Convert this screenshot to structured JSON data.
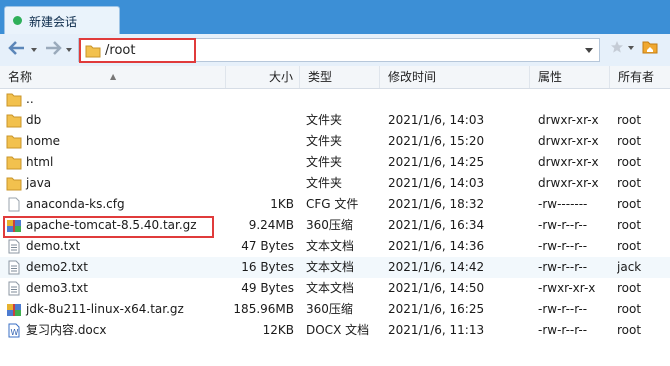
{
  "tab": {
    "label": "新建会话"
  },
  "address": {
    "path": "/root"
  },
  "columns": {
    "name": "名称",
    "size": "大小",
    "type": "类型",
    "mtime": "修改时间",
    "perm": "属性",
    "owner": "所有者"
  },
  "files": [
    {
      "name": "..",
      "size": "",
      "type": "",
      "mtime": "",
      "perm": "",
      "owner": "",
      "icon": "folder-up-icon"
    },
    {
      "name": "db",
      "size": "",
      "type": "文件夹",
      "mtime": "2021/1/6, 14:03",
      "perm": "drwxr-xr-x",
      "owner": "root",
      "icon": "folder-icon"
    },
    {
      "name": "home",
      "size": "",
      "type": "文件夹",
      "mtime": "2021/1/6, 15:20",
      "perm": "drwxr-xr-x",
      "owner": "root",
      "icon": "folder-icon"
    },
    {
      "name": "html",
      "size": "",
      "type": "文件夹",
      "mtime": "2021/1/6, 14:25",
      "perm": "drwxr-xr-x",
      "owner": "root",
      "icon": "folder-icon"
    },
    {
      "name": "java",
      "size": "",
      "type": "文件夹",
      "mtime": "2021/1/6, 14:03",
      "perm": "drwxr-xr-x",
      "owner": "root",
      "icon": "folder-icon"
    },
    {
      "name": "anaconda-ks.cfg",
      "size": "1KB",
      "type": "CFG 文件",
      "mtime": "2021/1/6, 18:32",
      "perm": "-rw-------",
      "owner": "root",
      "icon": "file-icon"
    },
    {
      "name": "apache-tomcat-8.5.40.tar.gz",
      "size": "9.24MB",
      "type": "360压缩",
      "mtime": "2021/1/6, 16:34",
      "perm": "-rw-r--r--",
      "owner": "root",
      "icon": "archive-icon"
    },
    {
      "name": "demo.txt",
      "size": "47 Bytes",
      "type": "文本文档",
      "mtime": "2021/1/6, 14:36",
      "perm": "-rw-r--r--",
      "owner": "root",
      "icon": "text-file-icon"
    },
    {
      "name": "demo2.txt",
      "size": "16 Bytes",
      "type": "文本文档",
      "mtime": "2021/1/6, 14:42",
      "perm": "-rw-r--r--",
      "owner": "jack",
      "icon": "text-file-icon"
    },
    {
      "name": "demo3.txt",
      "size": "49 Bytes",
      "type": "文本文档",
      "mtime": "2021/1/6, 14:50",
      "perm": "-rwxr-xr-x",
      "owner": "root",
      "icon": "text-file-icon"
    },
    {
      "name": "jdk-8u211-linux-x64.tar.gz",
      "size": "185.96MB",
      "type": "360压缩",
      "mtime": "2021/1/6, 16:25",
      "perm": "-rw-r--r--",
      "owner": "root",
      "icon": "archive-icon"
    },
    {
      "name": "复习内容.docx",
      "size": "12KB",
      "type": "DOCX 文档",
      "mtime": "2021/1/6, 11:13",
      "perm": "-rw-r--r--",
      "owner": "root",
      "icon": "word-doc-icon"
    }
  ],
  "colors": {
    "tabbar": "#3c8fd6",
    "highlight": "#e03b3b",
    "folder": "#f2c14e"
  }
}
